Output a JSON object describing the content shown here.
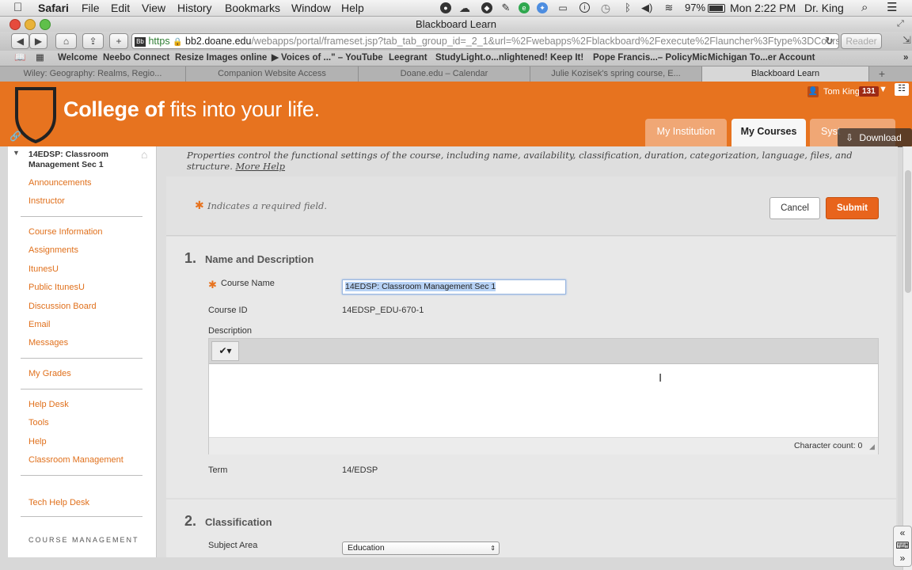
{
  "menubar": {
    "apple": "",
    "app": "Safari",
    "menus": [
      "File",
      "Edit",
      "View",
      "History",
      "Bookmarks",
      "Window",
      "Help"
    ],
    "battery": "97%",
    "clock": "Mon 2:22 PM",
    "user": "Dr. King"
  },
  "window": {
    "title": "Blackboard Learn"
  },
  "toolbar": {
    "url_https": "https",
    "url_host": "bb2.doane.edu",
    "url_path": "/webapps/portal/frameset.jsp?tab_tab_group_id=_2_1&url=%2Fwebapps%2Fblackboard%2Fexecute%2Flauncher%3Ftype%3DCourse%26id%",
    "reader": "Reader"
  },
  "bookmarks": [
    "Welcome",
    "Neebo Connect",
    "Resize Images online",
    "Voices of ...\" – YouTube",
    "Leegrant",
    "StudyLight.o...nlightened!",
    "Keep It!",
    "Pope Francis...– PolicyMic",
    "Michigan To...er Account"
  ],
  "tabs": [
    "Wiley: Geography: Realms, Regio...",
    "Companion Website Access",
    "Doane.edu – Calendar",
    "Julie Kozisek's spring course, E...",
    "Blackboard Learn"
  ],
  "header": {
    "tagline_bold": "College of",
    "tagline_rest": " fits into your life.",
    "user_name": "Tom King",
    "notif_count": "131",
    "nav_tabs": [
      "My Institution",
      "My Courses",
      "Syst"
    ],
    "download": "Download"
  },
  "sidebar": {
    "course_title": "14EDSP: Classroom Management Sec 1",
    "group1": [
      "Announcements",
      "Instructor"
    ],
    "group2": [
      "Course Information",
      "Assignments",
      "ItunesU",
      "Public ItunesU",
      "Discussion Board",
      "Email",
      "Messages"
    ],
    "group3": [
      "My Grades"
    ],
    "group4": [
      "Help Desk",
      "Tools",
      "Help",
      "Classroom Management"
    ],
    "group5": [
      "Tech Help Desk"
    ],
    "course_management": "COURSE MANAGEMENT"
  },
  "content": {
    "intro": "Properties control the functional settings of the course, including name, availability, classification, duration, categorization, language, files, and structure.",
    "more_help": "More Help",
    "required_note": "Indicates a required field.",
    "cancel": "Cancel",
    "submit": "Submit",
    "section1_num": "1.",
    "section1_title": "Name and Description",
    "course_name_label": "Course Name",
    "course_name_value": "14EDSP: Classroom Management Sec 1",
    "course_id_label": "Course ID",
    "course_id_value": "14EDSP_EDU-670-1",
    "description_label": "Description",
    "char_count": "Character count: 0",
    "term_label": "Term",
    "term_value": "14/EDSP",
    "section2_num": "2.",
    "section2_title": "Classification",
    "subject_area_label": "Subject Area",
    "subject_area_value": "Education"
  },
  "colors": {
    "brand_orange": "#e7731f",
    "link_orange": "#e0701c",
    "submit_orange": "#e8641c"
  }
}
